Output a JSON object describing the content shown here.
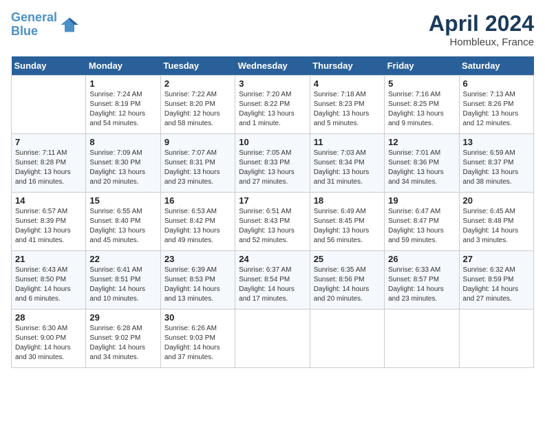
{
  "header": {
    "logo_line1": "General",
    "logo_line2": "Blue",
    "month": "April 2024",
    "location": "Hombleux, France"
  },
  "days_of_week": [
    "Sunday",
    "Monday",
    "Tuesday",
    "Wednesday",
    "Thursday",
    "Friday",
    "Saturday"
  ],
  "weeks": [
    [
      {
        "day": "",
        "info": ""
      },
      {
        "day": "1",
        "info": "Sunrise: 7:24 AM\nSunset: 8:19 PM\nDaylight: 12 hours\nand 54 minutes."
      },
      {
        "day": "2",
        "info": "Sunrise: 7:22 AM\nSunset: 8:20 PM\nDaylight: 12 hours\nand 58 minutes."
      },
      {
        "day": "3",
        "info": "Sunrise: 7:20 AM\nSunset: 8:22 PM\nDaylight: 13 hours\nand 1 minute."
      },
      {
        "day": "4",
        "info": "Sunrise: 7:18 AM\nSunset: 8:23 PM\nDaylight: 13 hours\nand 5 minutes."
      },
      {
        "day": "5",
        "info": "Sunrise: 7:16 AM\nSunset: 8:25 PM\nDaylight: 13 hours\nand 9 minutes."
      },
      {
        "day": "6",
        "info": "Sunrise: 7:13 AM\nSunset: 8:26 PM\nDaylight: 13 hours\nand 12 minutes."
      }
    ],
    [
      {
        "day": "7",
        "info": "Sunrise: 7:11 AM\nSunset: 8:28 PM\nDaylight: 13 hours\nand 16 minutes."
      },
      {
        "day": "8",
        "info": "Sunrise: 7:09 AM\nSunset: 8:30 PM\nDaylight: 13 hours\nand 20 minutes."
      },
      {
        "day": "9",
        "info": "Sunrise: 7:07 AM\nSunset: 8:31 PM\nDaylight: 13 hours\nand 23 minutes."
      },
      {
        "day": "10",
        "info": "Sunrise: 7:05 AM\nSunset: 8:33 PM\nDaylight: 13 hours\nand 27 minutes."
      },
      {
        "day": "11",
        "info": "Sunrise: 7:03 AM\nSunset: 8:34 PM\nDaylight: 13 hours\nand 31 minutes."
      },
      {
        "day": "12",
        "info": "Sunrise: 7:01 AM\nSunset: 8:36 PM\nDaylight: 13 hours\nand 34 minutes."
      },
      {
        "day": "13",
        "info": "Sunrise: 6:59 AM\nSunset: 8:37 PM\nDaylight: 13 hours\nand 38 minutes."
      }
    ],
    [
      {
        "day": "14",
        "info": "Sunrise: 6:57 AM\nSunset: 8:39 PM\nDaylight: 13 hours\nand 41 minutes."
      },
      {
        "day": "15",
        "info": "Sunrise: 6:55 AM\nSunset: 8:40 PM\nDaylight: 13 hours\nand 45 minutes."
      },
      {
        "day": "16",
        "info": "Sunrise: 6:53 AM\nSunset: 8:42 PM\nDaylight: 13 hours\nand 49 minutes."
      },
      {
        "day": "17",
        "info": "Sunrise: 6:51 AM\nSunset: 8:43 PM\nDaylight: 13 hours\nand 52 minutes."
      },
      {
        "day": "18",
        "info": "Sunrise: 6:49 AM\nSunset: 8:45 PM\nDaylight: 13 hours\nand 56 minutes."
      },
      {
        "day": "19",
        "info": "Sunrise: 6:47 AM\nSunset: 8:47 PM\nDaylight: 13 hours\nand 59 minutes."
      },
      {
        "day": "20",
        "info": "Sunrise: 6:45 AM\nSunset: 8:48 PM\nDaylight: 14 hours\nand 3 minutes."
      }
    ],
    [
      {
        "day": "21",
        "info": "Sunrise: 6:43 AM\nSunset: 8:50 PM\nDaylight: 14 hours\nand 6 minutes."
      },
      {
        "day": "22",
        "info": "Sunrise: 6:41 AM\nSunset: 8:51 PM\nDaylight: 14 hours\nand 10 minutes."
      },
      {
        "day": "23",
        "info": "Sunrise: 6:39 AM\nSunset: 8:53 PM\nDaylight: 14 hours\nand 13 minutes."
      },
      {
        "day": "24",
        "info": "Sunrise: 6:37 AM\nSunset: 8:54 PM\nDaylight: 14 hours\nand 17 minutes."
      },
      {
        "day": "25",
        "info": "Sunrise: 6:35 AM\nSunset: 8:56 PM\nDaylight: 14 hours\nand 20 minutes."
      },
      {
        "day": "26",
        "info": "Sunrise: 6:33 AM\nSunset: 8:57 PM\nDaylight: 14 hours\nand 23 minutes."
      },
      {
        "day": "27",
        "info": "Sunrise: 6:32 AM\nSunset: 8:59 PM\nDaylight: 14 hours\nand 27 minutes."
      }
    ],
    [
      {
        "day": "28",
        "info": "Sunrise: 6:30 AM\nSunset: 9:00 PM\nDaylight: 14 hours\nand 30 minutes."
      },
      {
        "day": "29",
        "info": "Sunrise: 6:28 AM\nSunset: 9:02 PM\nDaylight: 14 hours\nand 34 minutes."
      },
      {
        "day": "30",
        "info": "Sunrise: 6:26 AM\nSunset: 9:03 PM\nDaylight: 14 hours\nand 37 minutes."
      },
      {
        "day": "",
        "info": ""
      },
      {
        "day": "",
        "info": ""
      },
      {
        "day": "",
        "info": ""
      },
      {
        "day": "",
        "info": ""
      }
    ]
  ]
}
